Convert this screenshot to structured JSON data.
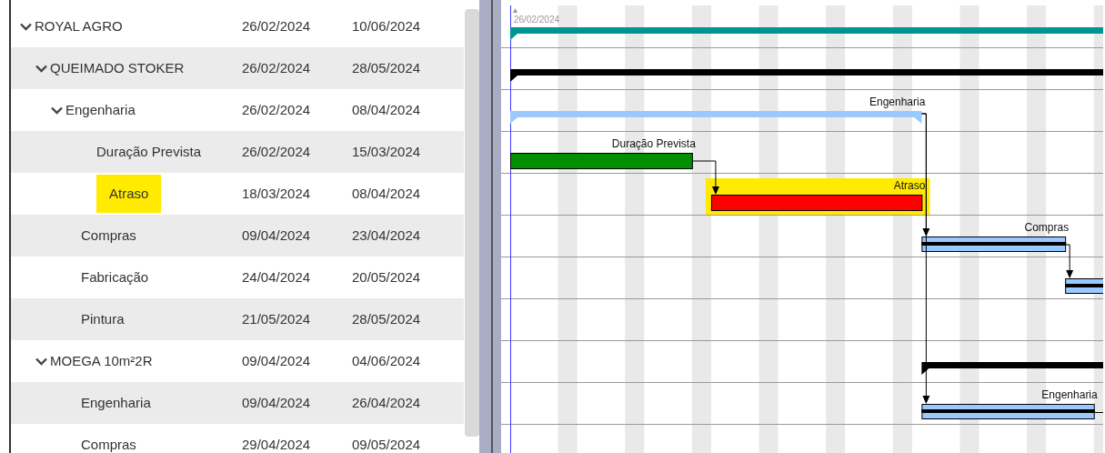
{
  "tasks": [
    {
      "name": "ROYAL AGRO",
      "start": "26/02/2024",
      "end": "10/06/2024",
      "expanded": true,
      "highlighted": false,
      "bar": {
        "kind": "summary",
        "color": "#009490"
      },
      "children": [
        {
          "name": "QUEIMADO STOKER",
          "start": "26/02/2024",
          "end": "28/05/2024",
          "expanded": true,
          "highlighted": false,
          "bar": {
            "kind": "summary",
            "color": "#000000"
          },
          "children": [
            {
              "name": "Engenharia",
              "start": "26/02/2024",
              "end": "08/04/2024",
              "expanded": true,
              "highlighted": false,
              "bar": {
                "kind": "summary",
                "color": "#99c9ff",
                "label": "Engenharia"
              },
              "children": [
                {
                  "name": "Duração Prevista",
                  "start": "26/02/2024",
                  "end": "15/03/2024",
                  "highlighted": false,
                  "bar": {
                    "kind": "task",
                    "color": "#008f00",
                    "label": "Duração Prevista"
                  }
                },
                {
                  "name": "Atraso",
                  "start": "18/03/2024",
                  "end": "08/04/2024",
                  "highlighted": true,
                  "bar": {
                    "kind": "task",
                    "color": "#ff0000",
                    "label": "Atraso"
                  }
                }
              ]
            },
            {
              "name": "Compras",
              "start": "09/04/2024",
              "end": "23/04/2024",
              "highlighted": false,
              "bar": {
                "kind": "baseline-task",
                "color": "#99c9ff",
                "label": "Compras"
              }
            },
            {
              "name": "Fabricação",
              "start": "24/04/2024",
              "end": "20/05/2024",
              "highlighted": false,
              "bar": {
                "kind": "baseline-task",
                "color": "#99c9ff"
              }
            },
            {
              "name": "Pintura",
              "start": "21/05/2024",
              "end": "28/05/2024",
              "highlighted": false
            }
          ]
        },
        {
          "name": "MOEGA 10m²2R",
          "start": "09/04/2024",
          "end": "04/06/2024",
          "expanded": true,
          "highlighted": false,
          "bar": {
            "kind": "summary",
            "color": "#000000"
          },
          "children": [
            {
              "name": "Engenharia",
              "start": "09/04/2024",
              "end": "26/04/2024",
              "highlighted": false,
              "bar": {
                "kind": "baseline-task",
                "color": "#99c9ff",
                "label": "Engenharia"
              }
            },
            {
              "name": "Compras",
              "start": "29/04/2024",
              "end": "09/05/2024",
              "highlighted": false
            }
          ]
        }
      ]
    }
  ],
  "gantt": {
    "start_label": "26/02/2024"
  }
}
